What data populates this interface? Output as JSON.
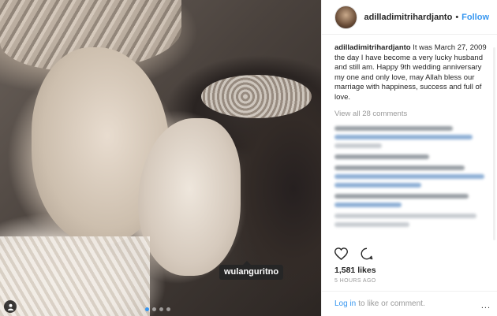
{
  "post": {
    "username": "adilladimitrihardjanto",
    "separator": "•",
    "follow_label": "Follow",
    "caption_user": "adilladimitrihardjanto",
    "caption_text": "It was March 27, 2009 the day I have become a very lucky husband and still am. Happy 9th wedding anniversary my one and only love, may Allah bless our marriage with happiness, success and full of love.",
    "view_all_label": "View all 28 comments",
    "likes": "1,581 likes",
    "time": "5 HOURS AGO",
    "tagged_user": "wulanguritno",
    "more_label": "..."
  },
  "footer": {
    "login_label": "Log in",
    "rest_label": "to like or comment."
  },
  "carousel": {
    "count": 4,
    "active_index": 0
  },
  "icons": {
    "heart": "heart-icon",
    "comment": "comment-icon",
    "user_tag": "user-tag-icon",
    "more": "more-icon"
  },
  "colors": {
    "link": "#3897f0",
    "text": "#262626",
    "muted": "#999999"
  }
}
